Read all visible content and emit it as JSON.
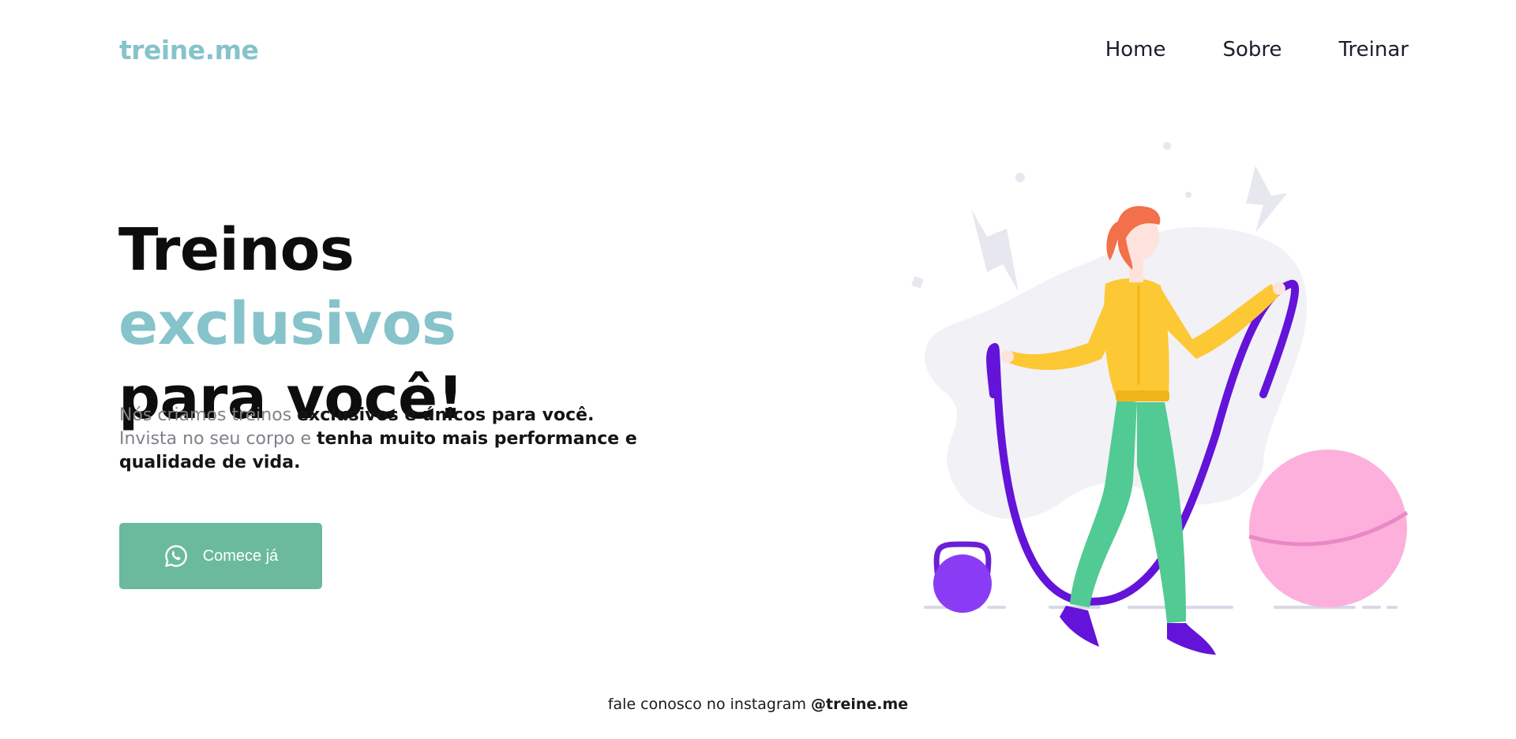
{
  "header": {
    "logo": "treine.me",
    "nav": [
      {
        "label": "Home"
      },
      {
        "label": "Sobre"
      },
      {
        "label": "Treinar"
      }
    ]
  },
  "hero": {
    "title_part1": "Treinos ",
    "title_accent": "exclusivos",
    "title_part2": "para você!",
    "text_1": "Nós criamos treinos ",
    "text_bold_1": "exclusivos e únicos para você.",
    "text_2": " Invista no seu corpo e ",
    "text_bold_2": "tenha muito mais performance e qualidade de vida.",
    "cta_label": "Comece já",
    "cta_icon": "whatsapp-icon"
  },
  "footer": {
    "text": "fale conosco no instagram ",
    "handle": "@treine.me"
  },
  "colors": {
    "accent": "#86c3cb",
    "button": "#6bba9d"
  }
}
